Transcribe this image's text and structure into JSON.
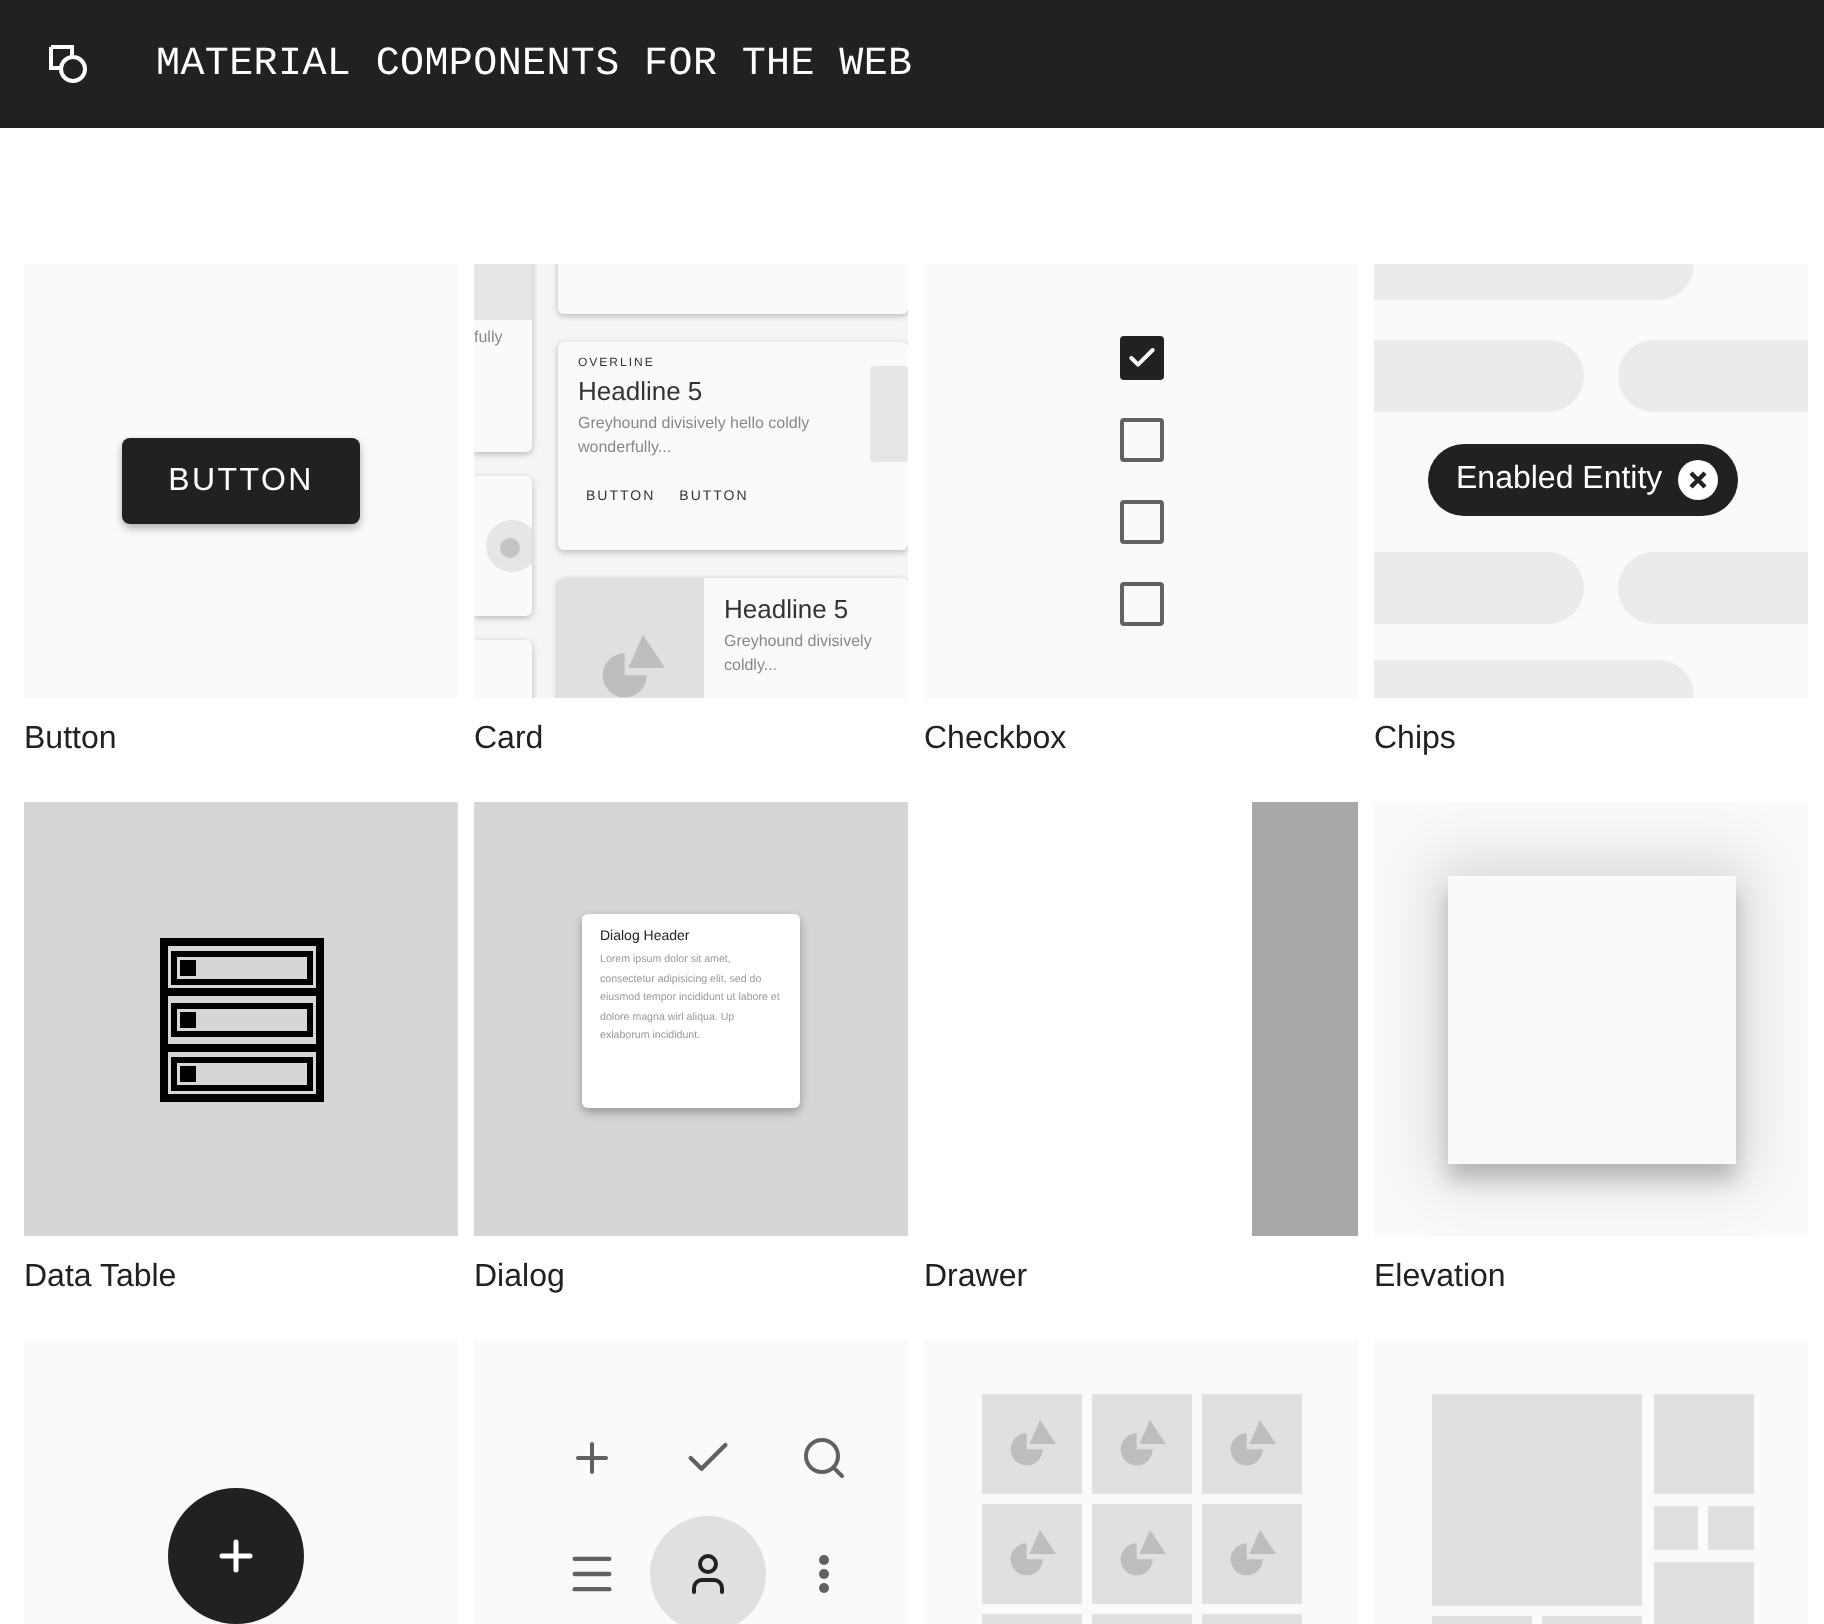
{
  "header": {
    "title": "MATERIAL COMPONENTS FOR THE WEB"
  },
  "tiles": [
    {
      "kind": "button",
      "label": "Button",
      "button_text": "BUTTON"
    },
    {
      "kind": "card",
      "label": "Card",
      "side_text": "fully",
      "card": {
        "overline": "OVERLINE",
        "headline": "Headline 5",
        "body": "Greyhound divisively hello coldly wonderfully...",
        "actions": [
          "BUTTON",
          "BUTTON"
        ]
      },
      "media_card": {
        "headline": "Headline 5",
        "body": "Greyhound divisively coldly..."
      }
    },
    {
      "kind": "checkbox",
      "label": "Checkbox",
      "checkboxes": [
        {
          "checked": true
        },
        {
          "checked": false
        },
        {
          "checked": false
        },
        {
          "checked": false
        }
      ]
    },
    {
      "kind": "chips",
      "label": "Chips",
      "chip_text": "Enabled Entity"
    },
    {
      "kind": "data-table",
      "label": "Data Table"
    },
    {
      "kind": "dialog",
      "label": "Dialog",
      "dialog": {
        "header": "Dialog Header",
        "body": "Lorem ipsum dolor sit amet, consectetur adipisicing elit, sed do eiusmod tempor incididunt ut labore et dolore magna wirl aliqua. Up exlaborum incididunt."
      }
    },
    {
      "kind": "drawer",
      "label": "Drawer"
    },
    {
      "kind": "elevation",
      "label": "Elevation"
    },
    {
      "kind": "fab"
    },
    {
      "kind": "icon-button"
    },
    {
      "kind": "image-list"
    },
    {
      "kind": "layout-grid"
    }
  ]
}
